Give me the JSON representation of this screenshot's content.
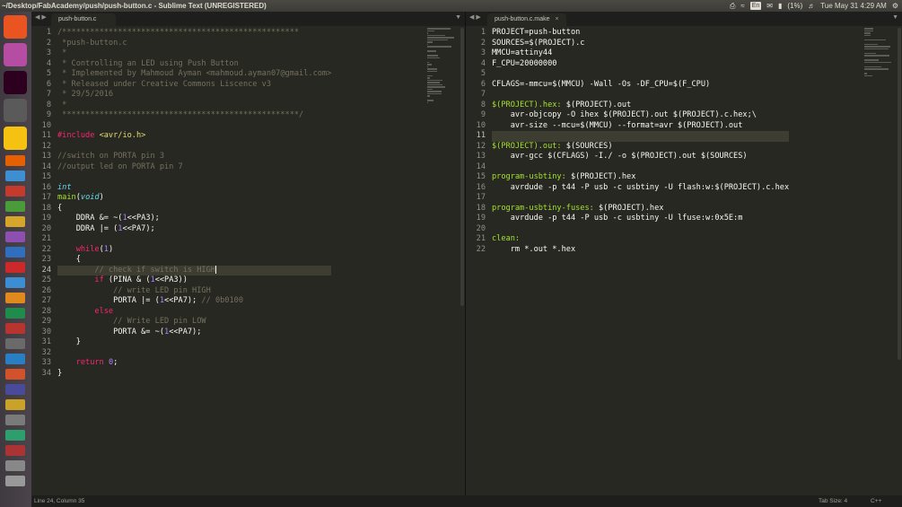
{
  "window": {
    "title": "~/Desktop/FabAcademy/push/push-button.c - Sublime Text (UNREGISTERED)"
  },
  "tray": {
    "battery": "(1%)",
    "keyboard": "En",
    "clock": "Tue May 31  4:29 AM"
  },
  "left_tab": {
    "label": "push-button.c"
  },
  "right_tab": {
    "label": "push-button.c.make"
  },
  "status": {
    "position": "Line 24, Column 35",
    "tab_size": "Tab Size: 4",
    "syntax": "C++"
  },
  "colors": {
    "editor_bg": "#272822",
    "comment": "#75715e",
    "keyword": "#f92672",
    "number": "#ae81ff",
    "string": "#e6db74",
    "type": "#66d9ef",
    "function": "#a6e22e"
  },
  "launcher": {
    "icons": [
      "ubuntu-icon",
      "unity-icon",
      "terminal-icon",
      "workspace-icon",
      "bulb-icon",
      "firefox-icon",
      "app-icon",
      "app-icon",
      "app-icon",
      "app-icon",
      "app-icon",
      "app-icon",
      "tube-icon",
      "app-icon",
      "app-icon",
      "app-icon",
      "app-icon",
      "app-icon",
      "calendar-icon",
      "app-icon",
      "app-icon",
      "app-icon",
      "app-icon",
      "app-icon",
      "app-icon",
      "app-icon",
      "app-icon"
    ]
  },
  "left_lines": [
    [
      [
        "c-com",
        "/***************************************************"
      ]
    ],
    [
      [
        "c-com",
        " *push-button.c"
      ]
    ],
    [
      [
        "c-com",
        " *"
      ]
    ],
    [
      [
        "c-com",
        " * Controlling an LED using Push Button"
      ]
    ],
    [
      [
        "c-com",
        " * Implemented by Mahmoud Ayman <mahmoud.ayman07@gmail.com>"
      ]
    ],
    [
      [
        "c-com",
        " * Released under Creative Commons Liscence v3"
      ]
    ],
    [
      [
        "c-com",
        " * 29/5/2016"
      ]
    ],
    [
      [
        "c-com",
        " *"
      ]
    ],
    [
      [
        "c-com",
        " ***************************************************/"
      ]
    ],
    [
      [
        "",
        ""
      ]
    ],
    [
      [
        "c-kw",
        "#include "
      ],
      [
        "c-str",
        "<avr/io.h>"
      ]
    ],
    [
      [
        "",
        ""
      ]
    ],
    [
      [
        "c-com",
        "//switch on PORTA pin 3"
      ]
    ],
    [
      [
        "c-com",
        "//output led on PORTA pin 7"
      ]
    ],
    [
      [
        "",
        ""
      ]
    ],
    [
      [
        "c-typ",
        "int"
      ]
    ],
    [
      [
        "c-fn",
        "main"
      ],
      [
        "",
        "("
      ],
      [
        "c-typ",
        "void"
      ],
      [
        "",
        ")"
      ]
    ],
    [
      [
        "",
        "{"
      ]
    ],
    [
      [
        "",
        "    DDRA &= ~("
      ],
      [
        "c-num",
        "1"
      ],
      [
        "",
        "<<PA3);"
      ]
    ],
    [
      [
        "",
        "    DDRA |= ("
      ],
      [
        "c-num",
        "1"
      ],
      [
        "",
        "<<PA7);"
      ]
    ],
    [
      [
        "",
        ""
      ]
    ],
    [
      [
        "c-kw",
        "    while"
      ],
      [
        "",
        "("
      ],
      [
        "c-num",
        "1"
      ],
      [
        "",
        ")"
      ]
    ],
    [
      [
        "",
        "    {"
      ]
    ],
    [
      [
        "c-com",
        "        // check if switch is HIGH"
      ]
    ],
    [
      [
        "c-kw",
        "        if"
      ],
      [
        "",
        " (PINA & ("
      ],
      [
        "c-num",
        "1"
      ],
      [
        "",
        "<<PA3))"
      ]
    ],
    [
      [
        "c-com",
        "            // write LED pin HIGH"
      ]
    ],
    [
      [
        "",
        "            PORTA |= ("
      ],
      [
        "c-num",
        "1"
      ],
      [
        "",
        "<<PA7); "
      ],
      [
        "c-com",
        "// 0b0100"
      ]
    ],
    [
      [
        "c-kw",
        "        else"
      ]
    ],
    [
      [
        "c-com",
        "            // Write LED pin LOW"
      ]
    ],
    [
      [
        "",
        "            PORTA &= ~("
      ],
      [
        "c-num",
        "1"
      ],
      [
        "",
        "<<PA7);"
      ]
    ],
    [
      [
        "",
        "    }"
      ]
    ],
    [
      [
        "",
        ""
      ]
    ],
    [
      [
        "c-kw",
        "    return"
      ],
      [
        "",
        " "
      ],
      [
        "c-num",
        "0"
      ],
      [
        "",
        ";"
      ]
    ],
    [
      [
        "",
        "}"
      ]
    ]
  ],
  "right_lines": [
    [
      [
        "",
        "PROJECT=push-button"
      ]
    ],
    [
      [
        "",
        "SOURCES=$(PROJECT).c"
      ]
    ],
    [
      [
        "",
        "MMCU=attiny44"
      ]
    ],
    [
      [
        "",
        "F_CPU=20000000"
      ]
    ],
    [
      [
        "",
        ""
      ]
    ],
    [
      [
        "",
        "CFLAGS=-mmcu=$(MMCU) -Wall -Os -DF_CPU=$(F_CPU)"
      ]
    ],
    [
      [
        "",
        ""
      ]
    ],
    [
      [
        "c-tgt",
        "$(PROJECT).hex:"
      ],
      [
        "",
        " $(PROJECT).out"
      ]
    ],
    [
      [
        "",
        "    avr-objcopy -O ihex $(PROJECT).out $(PROJECT).c.hex;\\"
      ]
    ],
    [
      [
        "",
        "    avr-size --mcu=$(MMCU) --format=avr $(PROJECT).out"
      ]
    ],
    [
      [
        "",
        ""
      ]
    ],
    [
      [
        "c-tgt",
        "$(PROJECT).out:"
      ],
      [
        "",
        " $(SOURCES)"
      ]
    ],
    [
      [
        "",
        "    avr-gcc $(CFLAGS) -I./ -o $(PROJECT).out $(SOURCES)"
      ]
    ],
    [
      [
        "",
        ""
      ]
    ],
    [
      [
        "c-tgt",
        "program-usbtiny:"
      ],
      [
        "",
        " $(PROJECT).hex"
      ]
    ],
    [
      [
        "",
        "    avrdude -p t44 -P usb -c usbtiny -U flash:w:$(PROJECT).c.hex"
      ]
    ],
    [
      [
        "",
        ""
      ]
    ],
    [
      [
        "c-tgt",
        "program-usbtiny-fuses:"
      ],
      [
        "",
        " $(PROJECT).hex"
      ]
    ],
    [
      [
        "",
        "    avrdude -p t44 -P usb -c usbtiny -U lfuse:w:0x5E:m"
      ]
    ],
    [
      [
        "",
        ""
      ]
    ],
    [
      [
        "c-tgt",
        "clean:"
      ]
    ],
    [
      [
        "",
        "    rm *.out *.hex"
      ]
    ]
  ]
}
